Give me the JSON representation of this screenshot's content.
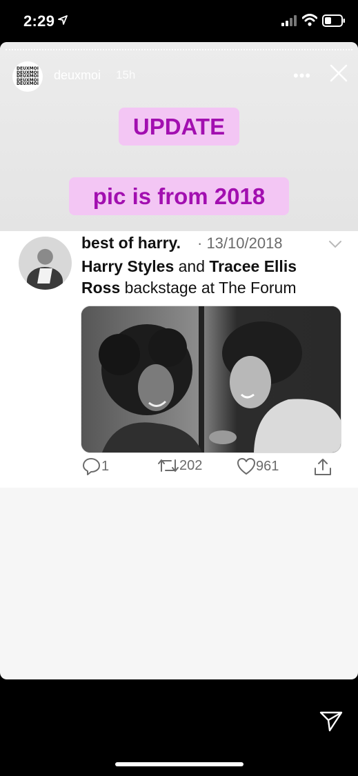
{
  "status_bar": {
    "time": "2:29",
    "location_icon": "location-arrow-icon",
    "signal_icon": "cellular-signal-icon",
    "wifi_icon": "wifi-icon",
    "battery_icon": "battery-icon"
  },
  "story": {
    "logo_lines": [
      "DEUXMOI",
      "DEUXMOI",
      "DEUXMOI",
      "DEUXMOI",
      "DEUXMOI"
    ],
    "username": "deuxmoi",
    "time_ago": "15h",
    "more_label": "•••",
    "close_icon": "close-icon",
    "stickers": {
      "update": "UPDATE",
      "pic": "pic is from 2018"
    },
    "colors": {
      "sticker_bg": "#f3c6f4",
      "sticker_text": "#a20fb0"
    }
  },
  "tweet": {
    "name": "best of harry.",
    "date": "· 13/10/2018",
    "text_parts": {
      "p1": "Harry Styles",
      "p2": " and ",
      "p3": "Tracee Ellis Ross",
      "p4": " backstage at The Forum"
    },
    "image_icon": "photo-black-and-white",
    "actions": {
      "replies": "1",
      "retweets": "202",
      "likes": "961"
    }
  },
  "bottom": {
    "send_icon": "send-paper-plane-icon"
  }
}
